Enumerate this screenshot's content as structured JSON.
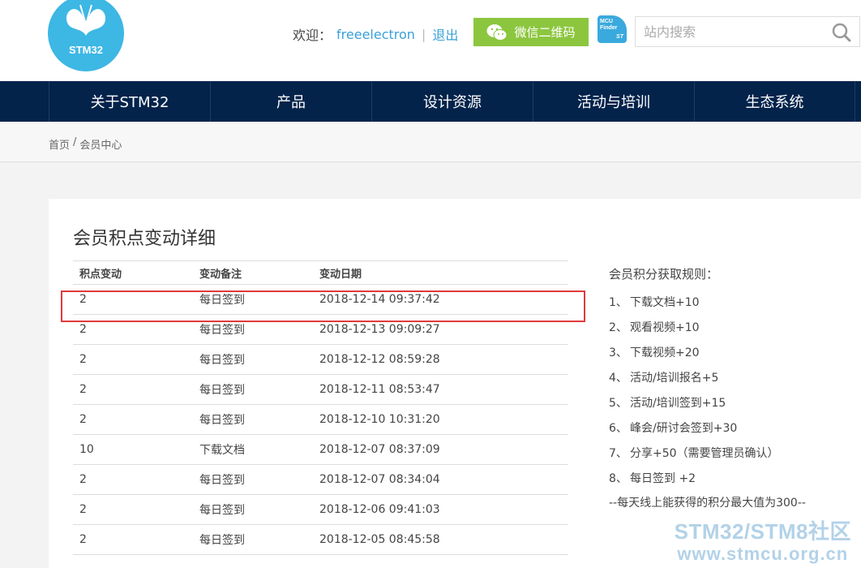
{
  "header": {
    "logo_text": "STM32",
    "welcome_label": "欢迎：",
    "username": "freeelectron",
    "separator": "|",
    "logout_label": "退出",
    "wechat_label": "微信二维码",
    "mcu_finder_line1": "MCU",
    "mcu_finder_line2": "Finder",
    "mcu_finder_brand": "ST",
    "search_placeholder": "站内搜索"
  },
  "nav": {
    "items": [
      {
        "label": "关于STM32"
      },
      {
        "label": "产品"
      },
      {
        "label": "设计资源"
      },
      {
        "label": "活动与培训"
      },
      {
        "label": "生态系统"
      }
    ]
  },
  "breadcrumb": {
    "home": "首页",
    "separator": "/",
    "current": "会员中心"
  },
  "main": {
    "title": "会员积点变动详细",
    "table": {
      "headers": [
        "积点变动",
        "变动备注",
        "变动日期"
      ],
      "rows": [
        [
          "2",
          "每日签到",
          "2018-12-14 09:37:42"
        ],
        [
          "2",
          "每日签到",
          "2018-12-13 09:09:27"
        ],
        [
          "2",
          "每日签到",
          "2018-12-12 08:59:28"
        ],
        [
          "2",
          "每日签到",
          "2018-12-11 08:53:47"
        ],
        [
          "2",
          "每日签到",
          "2018-12-10 10:31:20"
        ],
        [
          "10",
          "下载文档",
          "2018-12-07 08:37:09"
        ],
        [
          "2",
          "每日签到",
          "2018-12-07 08:34:04"
        ],
        [
          "2",
          "每日签到",
          "2018-12-06 09:41:03"
        ],
        [
          "2",
          "每日签到",
          "2018-12-05 08:45:58"
        ]
      ]
    }
  },
  "rules": {
    "title": "会员积分获取规则：",
    "items": [
      {
        "num": "1、",
        "text": "下载文档+10"
      },
      {
        "num": "2、",
        "text": "观看视频+10"
      },
      {
        "num": "3、",
        "text": "下载视频+20"
      },
      {
        "num": "4、",
        "text": "活动/培训报名+5"
      },
      {
        "num": "5、",
        "text": "活动/培训签到+15"
      },
      {
        "num": "6、",
        "text": "峰会/研讨会签到+30"
      },
      {
        "num": "7、",
        "text": "分享+50（需要管理员确认）"
      },
      {
        "num": "8、",
        "text": "每日签到 +2"
      }
    ],
    "note": "--每天线上能获得的积分最大值为300--"
  },
  "watermark": {
    "line1": "STM32/STM8社区",
    "line2": "www.stmcu.org.cn"
  },
  "colors": {
    "nav_bg": "#03234b",
    "accent_blue": "#3aa0d8",
    "wechat_green": "#8cc63f",
    "highlight_red": "#e03a3a"
  }
}
